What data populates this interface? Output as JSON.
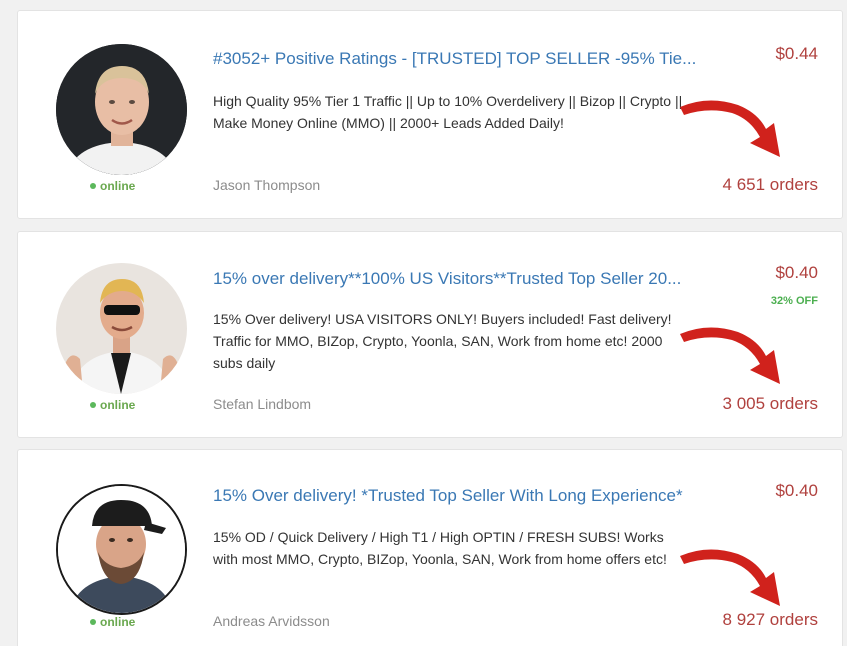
{
  "listings": [
    {
      "title": "#3052+ Positive Ratings - [TRUSTED] TOP SELLER -95% Tie...",
      "description": "High Quality 95% Tier 1 Traffic || Up to 10% Overdelivery || Bizop || Crypto || Make Money Online (MMO) || 2000+ Leads Added Daily!",
      "seller": "Jason Thompson",
      "status": "online",
      "price": "$0.44",
      "discount": "",
      "orders": "4 651 orders",
      "avatar_icon": "seller-photo-icon"
    },
    {
      "title": "15% over delivery**100% US Visitors**Trusted Top Seller 20...",
      "description": "15% Over delivery! USA VISITORS ONLY! Buyers included! Fast delivery! Traffic for MMO, BIZop, Crypto, Yoonla, SAN, Work from home etc! 2000 subs daily",
      "seller": "Stefan Lindbom",
      "status": "online",
      "price": "$0.40",
      "discount": "32% OFF",
      "orders": "3 005 orders",
      "avatar_icon": "seller-photo-icon"
    },
    {
      "title": "15% Over delivery! *Trusted Top Seller With Long Experience*",
      "description": "15% OD / Quick Delivery / High T1 / High OPTIN / FRESH SUBS! Works with most MMO, Crypto, BIZop, Yoonla, SAN, Work from home offers etc!",
      "seller": "Andreas Arvidsson",
      "status": "online",
      "price": "$0.40",
      "discount": "",
      "orders": "8 927 orders",
      "avatar_icon": "seller-photo-icon"
    }
  ],
  "colors": {
    "title": "#3a78b4",
    "price": "#b0413e",
    "online": "#6aa84f",
    "arrow": "#d0221c"
  }
}
